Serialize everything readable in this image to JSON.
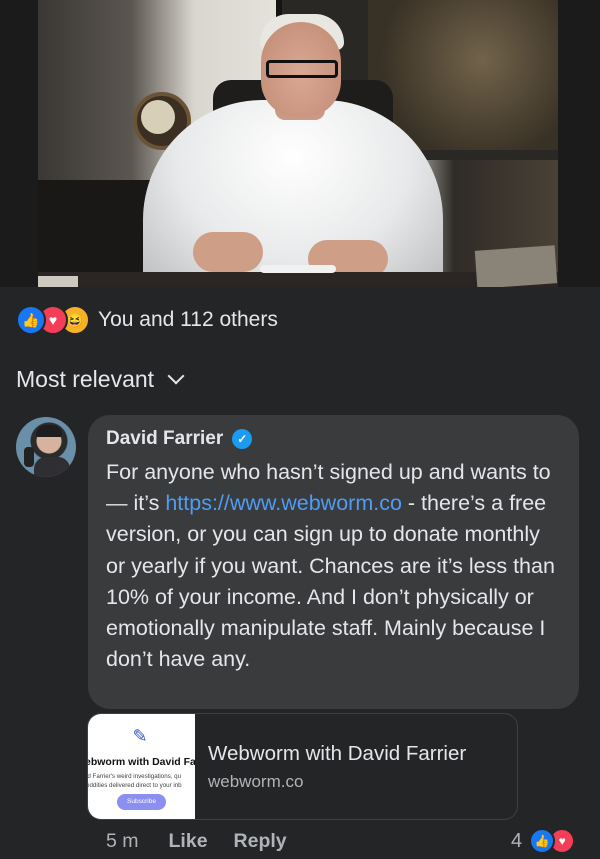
{
  "reactions": {
    "icons": [
      "like-icon",
      "love-icon",
      "haha-icon"
    ],
    "summary": "You and 112 others"
  },
  "sort": {
    "label": "Most relevant"
  },
  "comment": {
    "author": "David Farrier",
    "text_before_link": "For anyone who hasn’t signed up and wants to — it’s ",
    "link": "https://www.webworm.co",
    "text_after_link": " - there’s a free version, or you can sign up to donate monthly or yearly if you want. Chances are it’s less than 10% of your income. And I don’t physically or emotionally manipulate staff. Mainly because I don’t have any.",
    "time": "5 m",
    "like_label": "Like",
    "reply_label": "Reply",
    "reaction_count": "4",
    "reaction_icons": [
      "like-icon",
      "love-icon"
    ]
  },
  "link_preview": {
    "title": "Webworm with David Farrier",
    "domain": "webworm.co",
    "thumb_title": "ebworm with David Farri",
    "thumb_desc_1": "id Farrier's weird investigations, qu",
    "thumb_desc_2": "oddities delivered direct to your inb",
    "thumb_button": "Subscribe"
  },
  "colors": {
    "background": "#242526",
    "bubble": "#3a3b3c",
    "link": "#4f9cf5",
    "like": "#1877f2",
    "love": "#f33e58"
  }
}
